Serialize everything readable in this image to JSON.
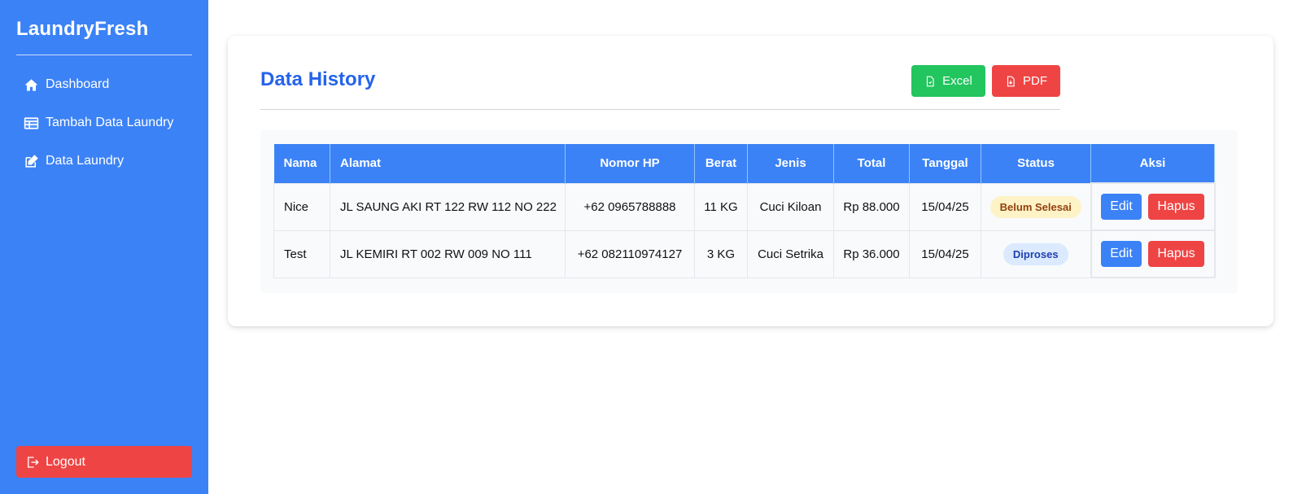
{
  "sidebar": {
    "brand": "LaundryFresh",
    "items": [
      {
        "label": "Dashboard",
        "icon": "home-icon"
      },
      {
        "label": "Tambah Data Laundry",
        "icon": "table-icon"
      },
      {
        "label": "Data Laundry",
        "icon": "edit-icon"
      }
    ],
    "logout_label": "Logout"
  },
  "main": {
    "title": "Data History",
    "export_excel_label": "Excel",
    "export_pdf_label": "PDF",
    "table": {
      "headers": [
        "Nama",
        "Alamat",
        "Nomor HP",
        "Berat",
        "Jenis",
        "Total",
        "Tanggal",
        "Status",
        "Aksi"
      ],
      "rows": [
        {
          "nama": "Nice",
          "alamat": "JL SAUNG AKI RT 122 RW 112 NO 222",
          "hp": "+62 0965788888",
          "berat": "11 KG",
          "jenis": "Cuci Kiloan",
          "total": "Rp 88.000",
          "tanggal": "15/04/25",
          "status": "Belum Selesai"
        },
        {
          "nama": "Test",
          "alamat": "JL KEMIRI RT 002 RW 009 NO 111",
          "hp": "+62 082110974127",
          "berat": "3 KG",
          "jenis": "Cuci Setrika",
          "total": "Rp 36.000",
          "tanggal": "15/04/25",
          "status": "Diproses"
        }
      ],
      "edit_label": "Edit",
      "delete_label": "Hapus"
    }
  },
  "colors": {
    "primary": "#3b82f6",
    "title": "#2563eb",
    "success": "#22c55e",
    "danger": "#ef4444",
    "badge_pending_bg": "#fef3c7",
    "badge_process_bg": "#dbeafe"
  }
}
